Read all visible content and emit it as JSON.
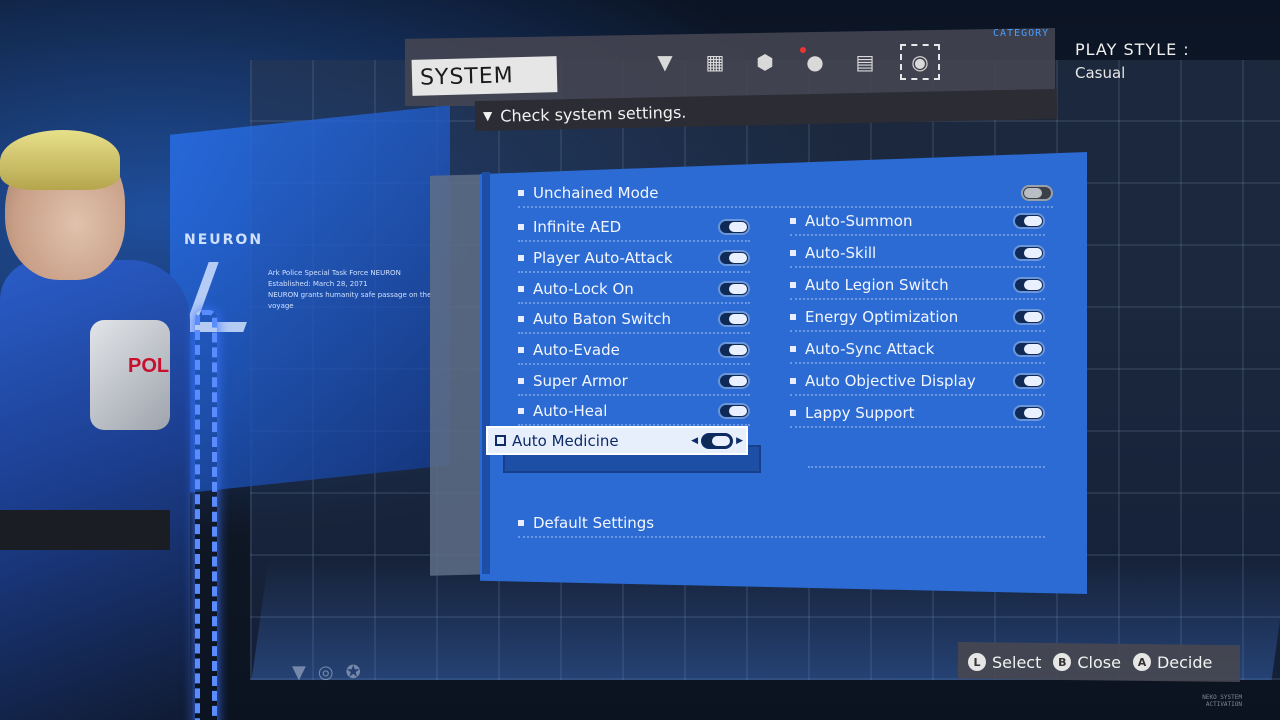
{
  "header": {
    "section_title": "SYSTEM",
    "hint": "Check system settings.",
    "category_label": "CATEGORY",
    "category_icons": [
      {
        "icon": "diamond-badge-icon",
        "active": false,
        "notify": false
      },
      {
        "icon": "nodes-icon",
        "active": false,
        "notify": false
      },
      {
        "icon": "hexagon-emblem-icon",
        "active": false,
        "notify": false
      },
      {
        "icon": "person-icon",
        "active": false,
        "notify": true
      },
      {
        "icon": "storage-icon",
        "active": false,
        "notify": false
      },
      {
        "icon": "toggle-icon",
        "active": true,
        "notify": false
      }
    ]
  },
  "play_style": {
    "label": "PLAY STYLE :",
    "value": "Casual"
  },
  "background": {
    "organization": "NEURON",
    "copy_line1": "Ark Police Special Task Force NEURON",
    "copy_line2": "Established: March 28, 2071",
    "copy_line3": "NEURON grants humanity safe passage on the voyage",
    "vest_text": "POL"
  },
  "settings": {
    "top_row": {
      "label": "Unchained Mode",
      "on": false
    },
    "left_column": [
      {
        "label": "Infinite AED",
        "on": true
      },
      {
        "label": "Player Auto-Attack",
        "on": true
      },
      {
        "label": "Auto-Lock On",
        "on": true
      },
      {
        "label": "Auto Baton Switch",
        "on": true
      },
      {
        "label": "Auto-Evade",
        "on": true
      },
      {
        "label": "Super Armor",
        "on": true
      },
      {
        "label": "Auto-Heal",
        "on": true
      }
    ],
    "right_column": [
      {
        "label": "Auto-Summon",
        "on": true
      },
      {
        "label": "Auto-Skill",
        "on": true
      },
      {
        "label": "Auto Legion Switch",
        "on": true
      },
      {
        "label": "Energy Optimization",
        "on": true
      },
      {
        "label": "Auto-Sync Attack",
        "on": true
      },
      {
        "label": "Auto Objective Display",
        "on": true
      },
      {
        "label": "Lappy Support",
        "on": true
      }
    ],
    "selected": {
      "label": "Auto Medicine",
      "on": true
    },
    "default_settings": "Default Settings"
  },
  "footer": {
    "select_button": "L",
    "select_label": "Select",
    "close_button": "B",
    "close_label": "Close",
    "decide_button": "A",
    "decide_label": "Decide",
    "corner_text": "NEKO SYSTEM ACTIVATION"
  },
  "colors": {
    "panel": "#2b6bd3",
    "accent": "#4a9dff",
    "toggle_knob": "#e9f0ff"
  }
}
